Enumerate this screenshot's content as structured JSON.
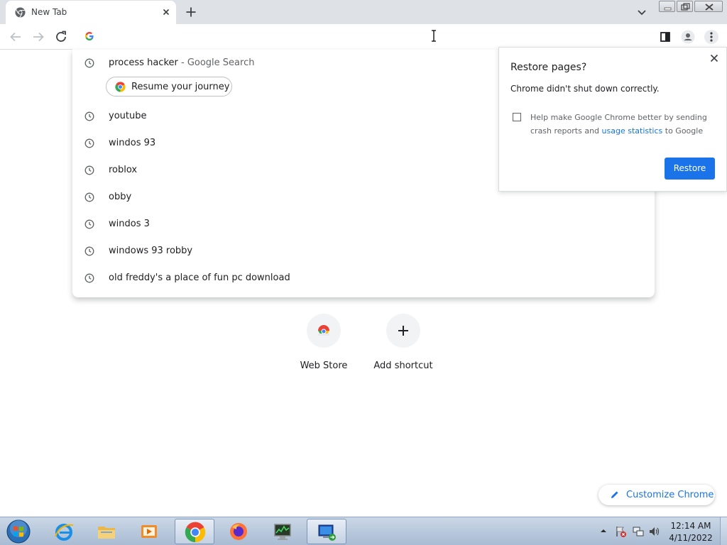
{
  "tab": {
    "title": "New Tab"
  },
  "omnibox": {
    "value": "",
    "placeholder": ""
  },
  "suggestions": [
    {
      "text": "process hacker",
      "suffix": " - Google Search"
    },
    {
      "text": "youtube",
      "suffix": ""
    },
    {
      "text": "windos 93",
      "suffix": ""
    },
    {
      "text": "roblox",
      "suffix": ""
    },
    {
      "text": "obby",
      "suffix": ""
    },
    {
      "text": "windos 3",
      "suffix": ""
    },
    {
      "text": "windows 93 robby",
      "suffix": ""
    },
    {
      "text": "old freddy's a place of fun pc download",
      "suffix": ""
    }
  ],
  "journey_chip": {
    "label": "Resume your journey"
  },
  "restore_bubble": {
    "title": "Restore pages?",
    "message": "Chrome didn't shut down correctly.",
    "help_prefix": "Help make Google Chrome better by sending crash reports and ",
    "help_link": "usage statistics",
    "help_suffix": " to Google",
    "button": "Restore"
  },
  "shortcuts": [
    {
      "label": "Web Store",
      "icon": "web-store-icon"
    },
    {
      "label": "Add shortcut",
      "icon": "plus-icon"
    }
  ],
  "customize": {
    "label": "Customize Chrome"
  },
  "taskbar": {
    "apps": [
      "internet-explorer",
      "file-explorer",
      "media-player",
      "chrome",
      "firefox",
      "task-manager",
      "remote-desktop"
    ],
    "time": "12:14 AM",
    "date": "4/11/2022"
  },
  "colors": {
    "accent": "#1a73e8",
    "tabstrip": "#dee1e6",
    "taskbar": "#b9cade"
  }
}
